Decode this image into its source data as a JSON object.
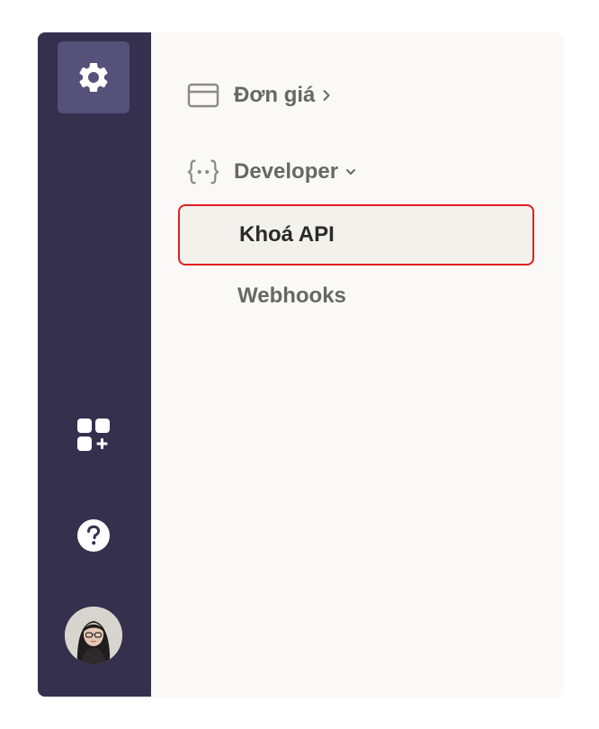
{
  "rail": {
    "settings_icon": "gear-icon",
    "apps_icon": "add-apps-icon",
    "help_icon": "help-icon",
    "avatar": "user-avatar"
  },
  "nav": {
    "billing": {
      "label": "Đơn giá",
      "icon": "credit-card-icon",
      "chevron": "chevron-right-icon"
    },
    "developer": {
      "label": "Developer",
      "icon": "code-braces-icon",
      "chevron": "chevron-down-icon",
      "children": [
        {
          "label": "Khoá API",
          "selected": true
        },
        {
          "label": "Webhooks",
          "selected": false
        }
      ]
    }
  },
  "colors": {
    "rail_bg": "#35304e",
    "rail_active": "#55517a",
    "panel_bg": "#faf9f7",
    "selected_bg": "#f2f1ec",
    "highlight_border": "#e0201e",
    "text_muted": "#676767",
    "text_strong": "#2a2a2a"
  }
}
